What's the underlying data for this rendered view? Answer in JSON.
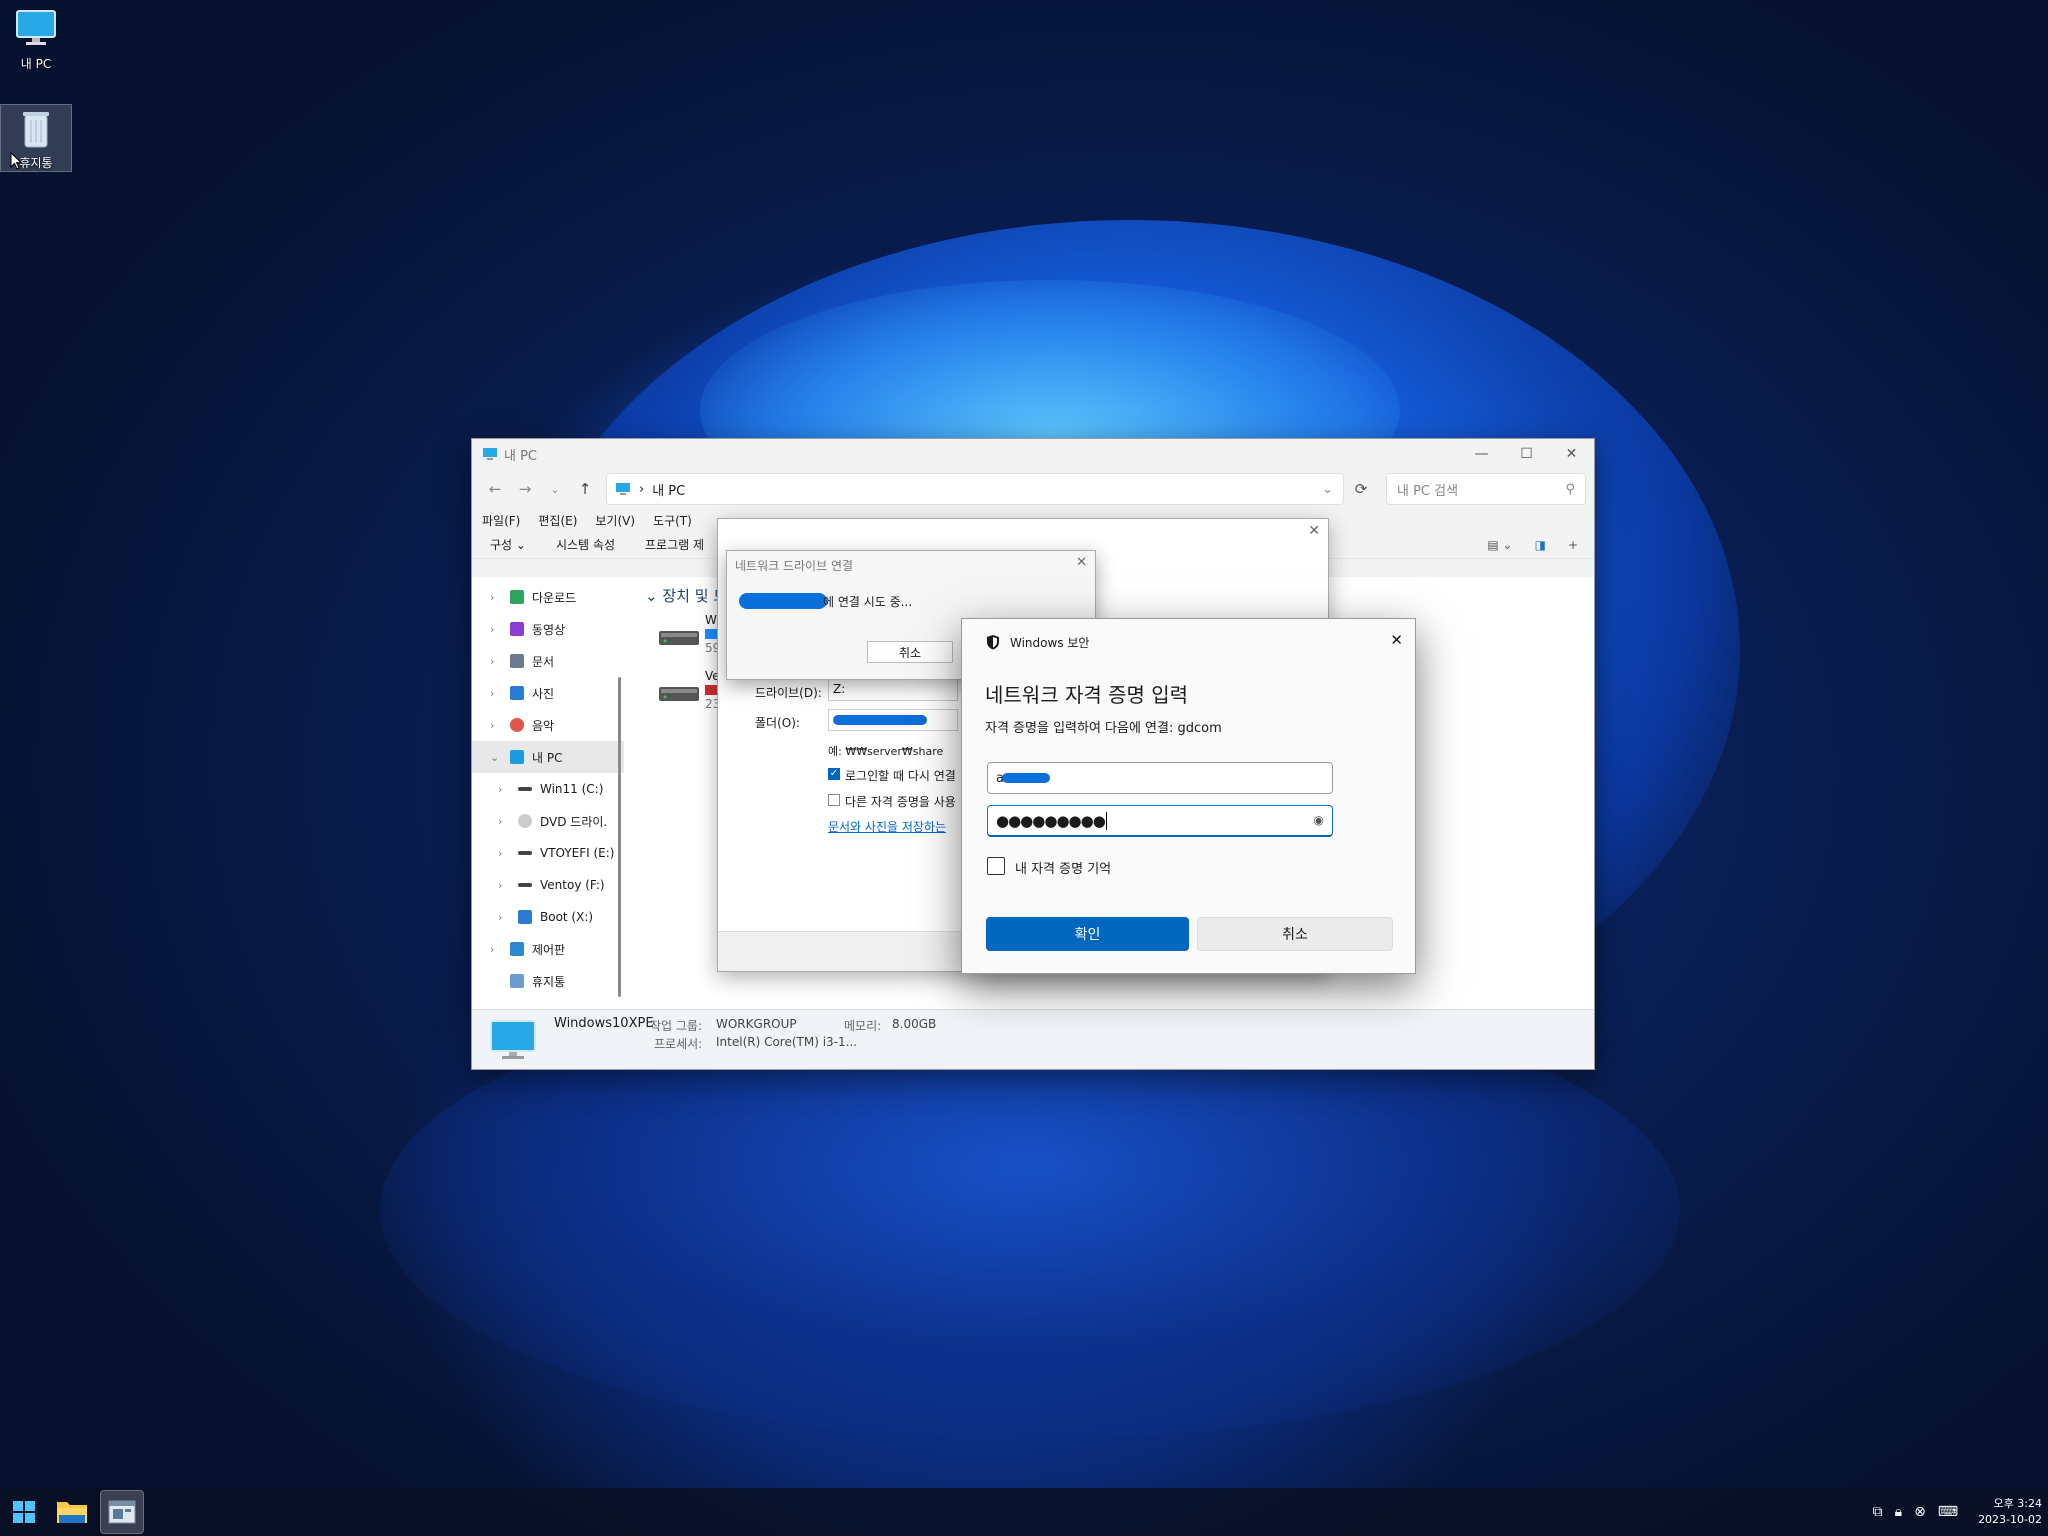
{
  "desktop": {
    "icons": [
      {
        "label": "내 PC"
      },
      {
        "label": "휴지통"
      }
    ]
  },
  "explorer": {
    "title": "내 PC",
    "address": {
      "path": "내 PC"
    },
    "search": {
      "placeholder": "내 PC 검색"
    },
    "menu": [
      "파일(F)",
      "편집(E)",
      "보기(V)",
      "도구(T)"
    ],
    "commands": [
      "구성",
      "시스템 속성",
      "프로그램 제"
    ],
    "sidebar": [
      {
        "label": "다운로드",
        "color": "#2aa55a"
      },
      {
        "label": "동영상",
        "color": "#8a3fd1"
      },
      {
        "label": "문서",
        "color": "#6c7a8f"
      },
      {
        "label": "사진",
        "color": "#2b7bd6"
      },
      {
        "label": "음악",
        "color": "#e0564a"
      },
      {
        "label": "내 PC",
        "color": "#1e9be0"
      },
      {
        "label": "Win11 (C:)",
        "color": "#444"
      },
      {
        "label": "DVD 드라이.",
        "color": "#bbb"
      },
      {
        "label": "VTOYEFI (E:)",
        "color": "#444"
      },
      {
        "label": "Ventoy (F:)",
        "color": "#444"
      },
      {
        "label": "Boot (X:)",
        "color": "#2a7dd1"
      },
      {
        "label": "제어판",
        "color": "#2a8ad1"
      },
      {
        "label": "휴지통",
        "color": "#6c9bd1"
      }
    ],
    "section_title": "장치 및 드",
    "drives": [
      {
        "name": "Wi",
        "detail": "59",
        "bar_color": "#1e90ff"
      },
      {
        "name": "Ve",
        "detail": "23",
        "bar_color": "#d32f2f"
      }
    ],
    "status": {
      "computer": "Windows10XPE",
      "workgroup_label": "작업 그룹:",
      "workgroup": "WORKGROUP",
      "memory_label": "메모리:",
      "memory": "8.00GB",
      "processor_label": "프로세서:",
      "processor": "Intel(R) Core(TM) i3-1..."
    }
  },
  "map_dialog": {
    "drive_label": "드라이브(D):",
    "drive_value": "Z:",
    "folder_label": "폴더(O):",
    "example": "예: ₩₩server₩share",
    "reconnect_label": "로그인할 때 다시 연결",
    "reconnect_checked": true,
    "other_creds_label": "다른 자격 증명을 사용",
    "other_creds_checked": false,
    "link": "문서와 사진을 저장하는"
  },
  "connecting_dialog": {
    "title": "네트워크 드라이브 연결",
    "message": "에 연결 시도 중...",
    "cancel": "취소"
  },
  "security_dialog": {
    "title": "Windows 보안",
    "heading": "네트워크 자격 증명 입력",
    "subtitle": "자격 증명을 입력하여 다음에 연결: gdcom",
    "username_value": "a",
    "password_value": "●●●●●●●●●",
    "remember_label": "내 자격 증명 기억",
    "remember_checked": false,
    "ok": "확인",
    "cancel": "취소"
  },
  "taskbar": {
    "time": "오후 3:24",
    "date": "2023-10-02"
  },
  "colors": {
    "accent": "#0067c0",
    "redaction": "#0a6fd8"
  }
}
